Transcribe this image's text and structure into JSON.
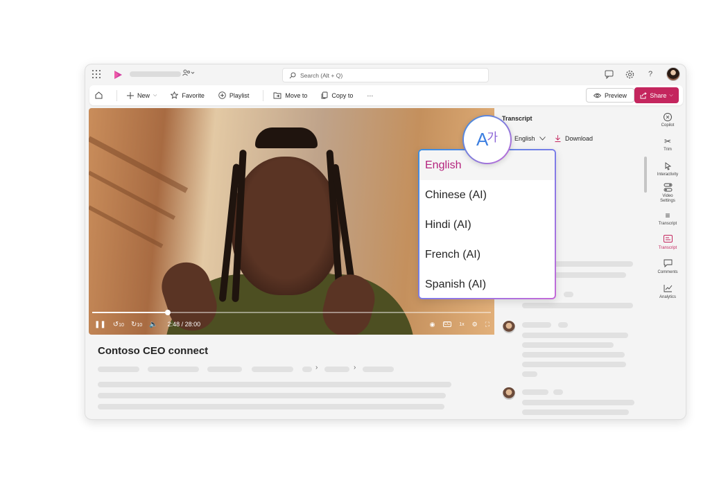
{
  "app": {
    "search_placeholder": "Search (Alt + Q)",
    "brand_color": "#c4265e"
  },
  "commandbar": {
    "new_label": "New",
    "favorite_label": "Favorite",
    "playlist_label": "Playlist",
    "moveto_label": "Move to",
    "copyto_label": "Copy to",
    "more_label": "···",
    "preview_label": "Preview",
    "share_label": "Share"
  },
  "video": {
    "time": "2:48 / 28:00",
    "progress_fraction": 0.19,
    "skip_back": "10",
    "skip_fwd": "10",
    "speed": "1x",
    "title": "Contoso CEO connect"
  },
  "transcript": {
    "heading": "Transcript",
    "selected_language": "English",
    "download_label": "Download"
  },
  "language_menu": {
    "options": [
      "English",
      "Chinese (AI)",
      "Hindi (AI)",
      "French (AI)",
      "Spanish (AI)"
    ],
    "selected_index": 0,
    "badge_latin": "A",
    "badge_korean": "가"
  },
  "rail": {
    "items": [
      "Copilot",
      "Trim",
      "Interactivity",
      "Video Settings",
      "Transcript",
      "Transcript",
      "Comments",
      "Analytics"
    ],
    "active_index": 5
  }
}
